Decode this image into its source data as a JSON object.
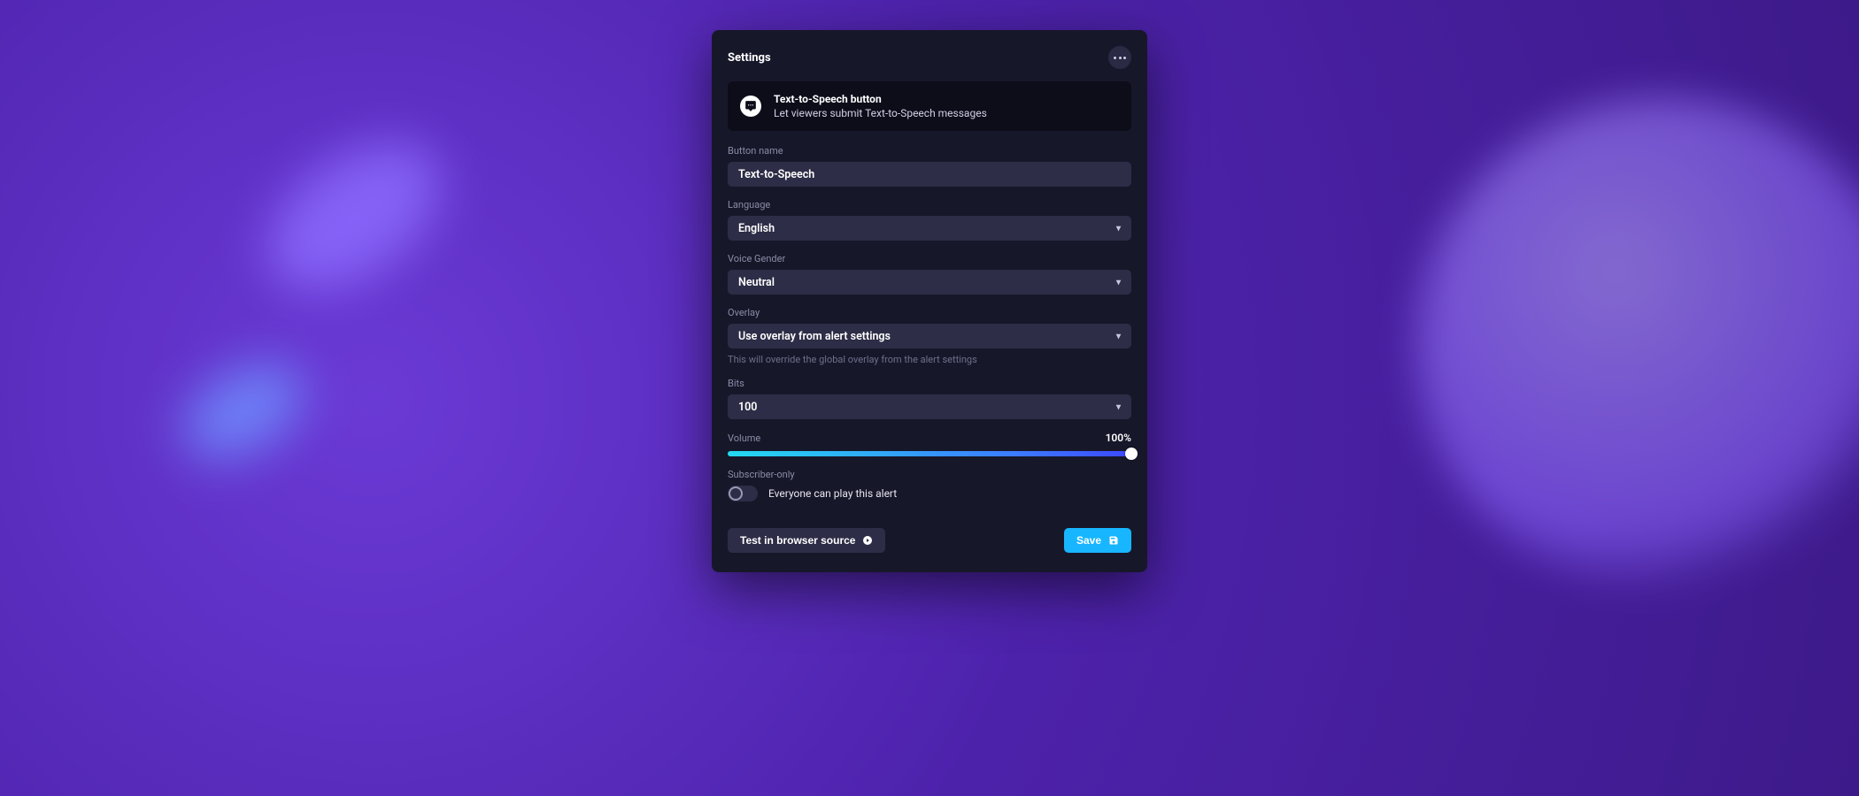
{
  "modal": {
    "title": "Settings",
    "banner": {
      "title": "Text-to-Speech button",
      "subtitle": "Let viewers submit Text-to-Speech messages"
    },
    "fields": {
      "button_name": {
        "label": "Button name",
        "value": "Text-to-Speech"
      },
      "language": {
        "label": "Language",
        "value": "English"
      },
      "voice_gender": {
        "label": "Voice Gender",
        "value": "Neutral"
      },
      "overlay": {
        "label": "Overlay",
        "value": "Use overlay from alert settings",
        "help": "This will override the global overlay from the alert settings"
      },
      "bits": {
        "label": "Bits",
        "value": "100"
      },
      "volume": {
        "label": "Volume",
        "value_text": "100%",
        "percent": 100
      },
      "subscriber_only": {
        "label": "Subscriber-only",
        "state_text": "Everyone can play this alert",
        "on": false
      }
    },
    "footer": {
      "test_label": "Test in browser source",
      "save_label": "Save"
    }
  }
}
